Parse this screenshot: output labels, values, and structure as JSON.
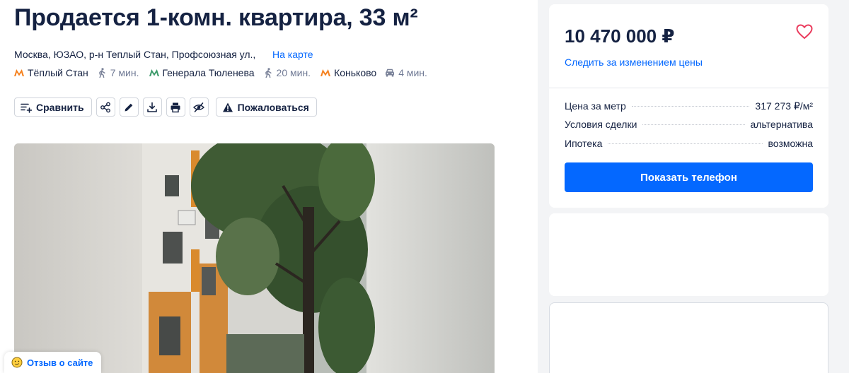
{
  "listing": {
    "title": "Продается 1-комн. квартира, 33 м²",
    "address": "Москва, ЮЗАО, р-н Теплый Стан, Профсоюзная ул.,",
    "map_link": "На карте",
    "metro": [
      {
        "name": "Тёплый Стан",
        "time": "7 мин.",
        "transport": "walk-icon",
        "line_color": "#f58220"
      },
      {
        "name": "Генерала Тюленева",
        "time": "20 мин.",
        "transport": "walk-icon",
        "line_color": "#3d9b6b"
      },
      {
        "name": "Коньково",
        "time": "4 мин.",
        "transport": "car-icon",
        "line_color": "#f58220"
      }
    ]
  },
  "toolbar": {
    "compare_label": "Сравнить",
    "report_label": "Пожаловаться",
    "icons": [
      "compare-icon",
      "share-icon",
      "edit-icon",
      "download-icon",
      "print-icon",
      "hide-icon",
      "warning-icon"
    ]
  },
  "sidebar": {
    "price": "10 470 000 ₽",
    "watch_price": "Следить за изменением цены",
    "rows": [
      {
        "label": "Цена за метр",
        "value": "317 273 ₽/м²"
      },
      {
        "label": "Условия сделки",
        "value": "альтернатива"
      },
      {
        "label": "Ипотека",
        "value": "возможна"
      }
    ],
    "phone_button": "Показать телефон"
  },
  "feedback": {
    "label": "Отзыв о сайте"
  },
  "colors": {
    "accent": "#0468ff",
    "text": "#152242",
    "muted": "#707a95"
  }
}
